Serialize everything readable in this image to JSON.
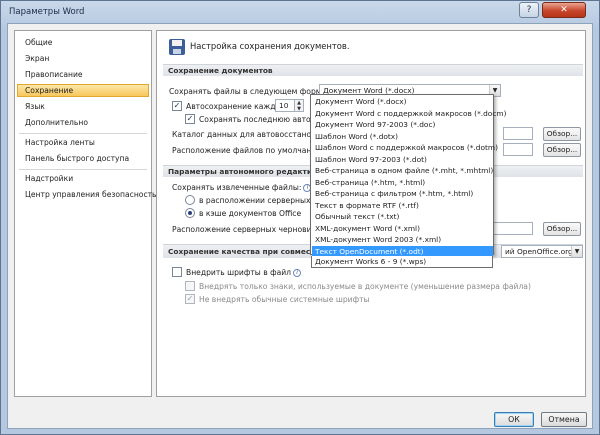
{
  "window": {
    "title": "Параметры Word",
    "help_glyph": "?",
    "close_glyph": "✕"
  },
  "nav": {
    "group1": [
      "Общие",
      "Экран",
      "Правописание",
      "Сохранение",
      "Язык",
      "Дополнительно"
    ],
    "group2": [
      "Настройка ленты",
      "Панель быстрого доступа"
    ],
    "group3": [
      "Надстройки",
      "Центр управления безопасностью"
    ]
  },
  "panel": {
    "header": "Настройка сохранения документов.",
    "save_section": {
      "title": "Сохранение документов",
      "format_label": "Сохранять файлы в следующем формате:",
      "format_value": "Документ Word (*.docx)",
      "autosave_label": "Автосохранение каждые",
      "autosave_value": "10",
      "keep_last_label": "Сохранять последнюю автосохранен",
      "autorecover_label": "Каталог данных для автовосстановления:",
      "default_location_label": "Расположение файлов по умолчанию:",
      "browse_label": "Обзор..."
    },
    "offline_section": {
      "title": "Параметры автономного редактирования д",
      "save_extracted_label": "Сохранять извлеченные файлы:",
      "radio1_label": "в расположении серверных черно",
      "radio2_label": "в кэше документов Office",
      "server_drafts_label": "Расположение серверных черновиков:",
      "server_drafts_value": "C",
      "browse_label": "Обзор..."
    },
    "fidelity_section": {
      "title": "Сохранение качества при совместном испо",
      "combo_value": "ий OpenOffice.org",
      "embed_fonts_label": "Внедрить шрифты в файл",
      "embed_only_used_label": "Внедрять только знаки, используемые в документе (уменьшение размера файла)",
      "no_system_fonts_label": "Не внедрять обычные системные шрифты"
    }
  },
  "dropdown": {
    "options": [
      "Документ Word (*.docx)",
      "Документ Word с поддержкой макросов (*.docm)",
      "Документ Word 97-2003 (*.doc)",
      "Шаблон Word (*.dotx)",
      "Шаблон Word с поддержкой макросов (*.dotm)",
      "Шаблон Word 97-2003 (*.dot)",
      "Веб-страница в одном файле (*.mht, *.mhtml)",
      "Веб-страница (*.htm, *.html)",
      "Веб-страница с фильтром (*.htm, *.html)",
      "Текст в формате RTF (*.rtf)",
      "Обычный текст (*.txt)",
      "XML-документ Word (*.xml)",
      "XML-документ Word 2003 (*.xml)",
      "Текст OpenDocument (*.odt)",
      "Документ Works 6 - 9 (*.wps)"
    ],
    "selected_index": 13
  },
  "footer": {
    "ok_label": "ОК",
    "cancel_label": "Отмена"
  },
  "colors": {
    "selection": "#3399ff",
    "nav_selected": "#f7c75b"
  }
}
